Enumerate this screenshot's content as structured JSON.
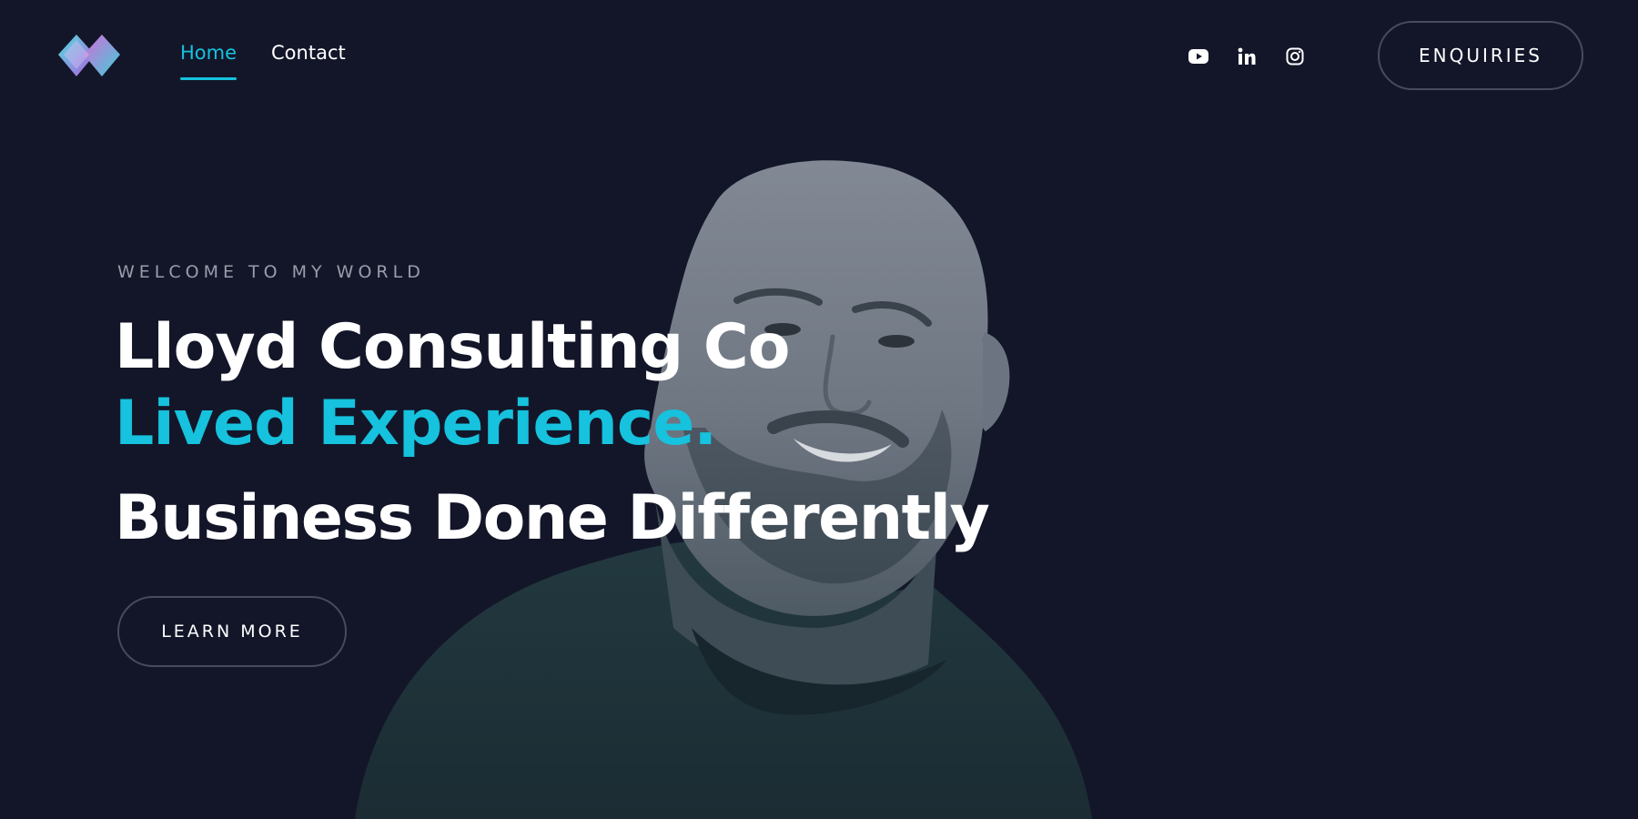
{
  "header": {
    "logo_name": "diamond-logo",
    "nav": [
      {
        "label": "Home",
        "active": true
      },
      {
        "label": "Contact",
        "active": false
      }
    ],
    "socials": [
      "youtube-icon",
      "linkedin-icon",
      "instagram-icon"
    ],
    "enquiries_label": "ENQUIRIES"
  },
  "hero": {
    "eyebrow": "WELCOME TO MY WORLD",
    "headline_1": "Lloyd Consulting Co",
    "headline_2": "Lived Experience.",
    "headline_3": "Business Done Differently",
    "cta_label": "LEARN MORE"
  },
  "colors": {
    "background": "#131629",
    "accent": "#16c2dd",
    "muted_text": "#9a9caa",
    "button_border": "#484b5d"
  }
}
